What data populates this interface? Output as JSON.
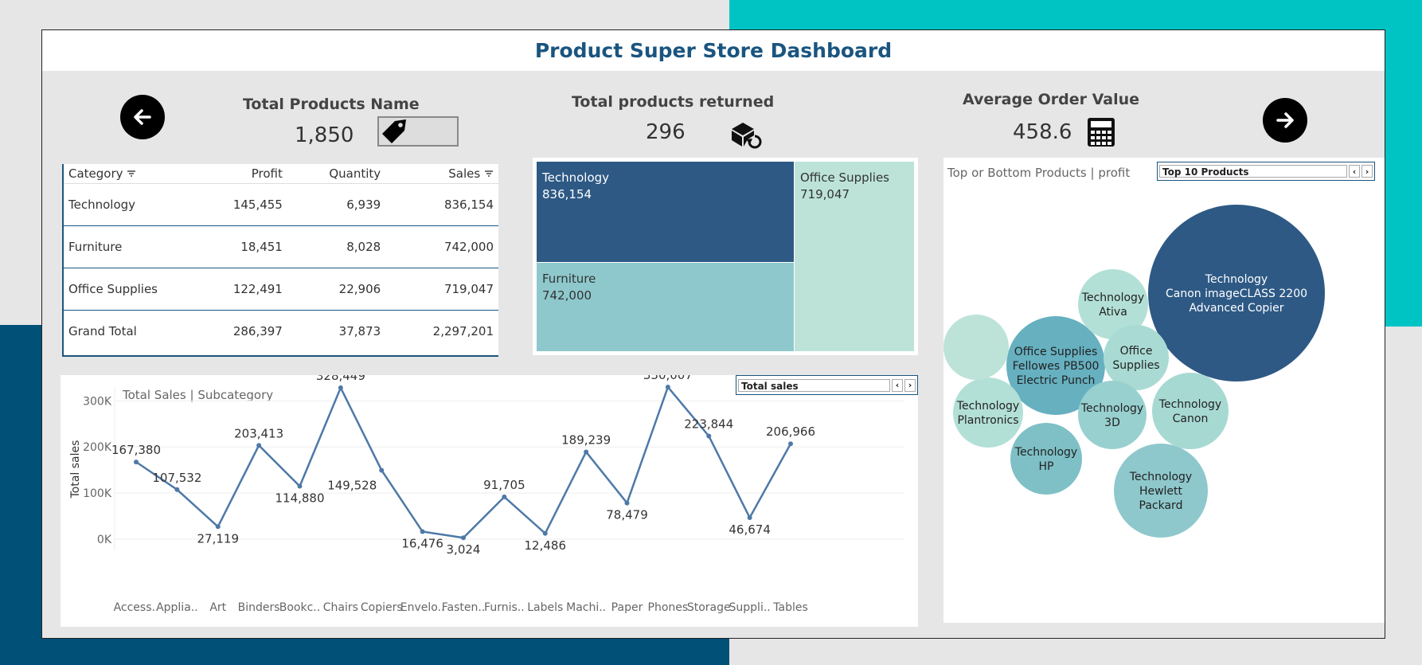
{
  "dashboard": {
    "title": "Product Super Store  Dashboard"
  },
  "kpis": {
    "total_products": {
      "title": "Total Products Name",
      "value": "1,850"
    },
    "returned": {
      "title": "Total products returned",
      "value": "296"
    },
    "aov": {
      "title": "Average Order Value",
      "value": "458.6"
    }
  },
  "icons": {
    "prev": "arrow-left-icon",
    "next": "arrow-right-icon",
    "tag": "price-tag-icon",
    "return": "box-return-icon",
    "calc": "calculator-icon",
    "sort": "sort-icon"
  },
  "table": {
    "headers": [
      "Category",
      "Profit",
      "Quantity",
      "Sales"
    ],
    "rows": [
      {
        "category": "Technology",
        "profit": "145,455",
        "quantity": "6,939",
        "sales": "836,154"
      },
      {
        "category": "Furniture",
        "profit": "18,451",
        "quantity": "8,028",
        "sales": "742,000"
      },
      {
        "category": "Office Supplies",
        "profit": "122,491",
        "quantity": "22,906",
        "sales": "719,047"
      },
      {
        "category": "Grand Total",
        "profit": "286,397",
        "quantity": "37,873",
        "sales": "2,297,201"
      }
    ]
  },
  "treemap": {
    "items": [
      {
        "name": "Technology",
        "value": "836,154",
        "color": "#2e5985"
      },
      {
        "name": "Office Supplies",
        "value": "719,047",
        "color": "#bde3d9"
      },
      {
        "name": "Furniture",
        "value": "742,000",
        "color": "#8ec8cc"
      }
    ]
  },
  "bubbles": {
    "title": "Top or Bottom Products | profit",
    "filter_value": "Top 10 Products",
    "items": [
      {
        "lines": [
          "Technology",
          "Canon imageCLASS 2200",
          "Advanced Copier"
        ],
        "color": "#2e5985",
        "text_color": "#ffffff"
      },
      {
        "lines": [
          "Office Supplies",
          "Fellowes PB500",
          "Electric Punch"
        ],
        "color": "#66b0c0",
        "text_color": "#222222"
      },
      {
        "lines": [
          "Technology",
          "Hewlett",
          "Packard"
        ],
        "color": "#8ec8cc",
        "text_color": "#222222"
      },
      {
        "lines": [
          "Technology",
          "Canon"
        ],
        "color": "#a7d9d3",
        "text_color": "#222222"
      },
      {
        "lines": [
          "Technology",
          "Ativa"
        ],
        "color": "#b3e0d6",
        "text_color": "#222222"
      },
      {
        "lines": [
          "Office",
          "Supplies"
        ],
        "color": "#a9dbd4",
        "text_color": "#222222"
      },
      {
        "lines": [
          "Technology",
          "3D"
        ],
        "color": "#98d0cf",
        "text_color": "#222222"
      },
      {
        "lines": [
          "Technology",
          "HP"
        ],
        "color": "#7ec0c6",
        "text_color": "#222222"
      },
      {
        "lines": [
          "Technology",
          "Plantronics"
        ],
        "color": "#b3e0d6",
        "text_color": "#222222"
      },
      {
        "lines": [],
        "color": "#bde3d9",
        "text_color": "#222222"
      }
    ]
  },
  "line_section": {
    "title": "Total Sales | Subcategory",
    "filter_value": "Total sales"
  },
  "chart_data": {
    "type": "line",
    "title": "Total Sales | Subcategory",
    "ylabel": "Total sales",
    "xlabel": "",
    "categories": [
      "Access..",
      "Applia..",
      "Art",
      "Binders",
      "Bookc..",
      "Chairs",
      "Copiers",
      "Envelo..",
      "Fasten..",
      "Furnis..",
      "Labels",
      "Machi..",
      "Paper",
      "Phones",
      "Storage",
      "Suppli..",
      "Tables"
    ],
    "values": [
      167380,
      107532,
      27119,
      203413,
      114880,
      328449,
      149528,
      16476,
      3024,
      91705,
      12486,
      189239,
      78479,
      330007,
      223844,
      46674,
      206966
    ],
    "labels": [
      "167,380",
      "107,532",
      "27,119",
      "203,413",
      "114,880",
      "328,449",
      "149,528",
      "16,476",
      "3,024",
      "91,705",
      "12,486",
      "189,239",
      "78,479",
      "330,007",
      "223,844",
      "46,674",
      "206,966"
    ],
    "label_pos": [
      "above",
      "above",
      "below",
      "above",
      "below",
      "above",
      "left",
      "below",
      "below",
      "above",
      "below",
      "above",
      "below",
      "above",
      "above",
      "below",
      "above"
    ],
    "yticks": [
      "0K",
      "100K",
      "200K",
      "300K"
    ],
    "ylim": [
      0,
      330000
    ],
    "color": "#4e79a7",
    "grid": true
  }
}
